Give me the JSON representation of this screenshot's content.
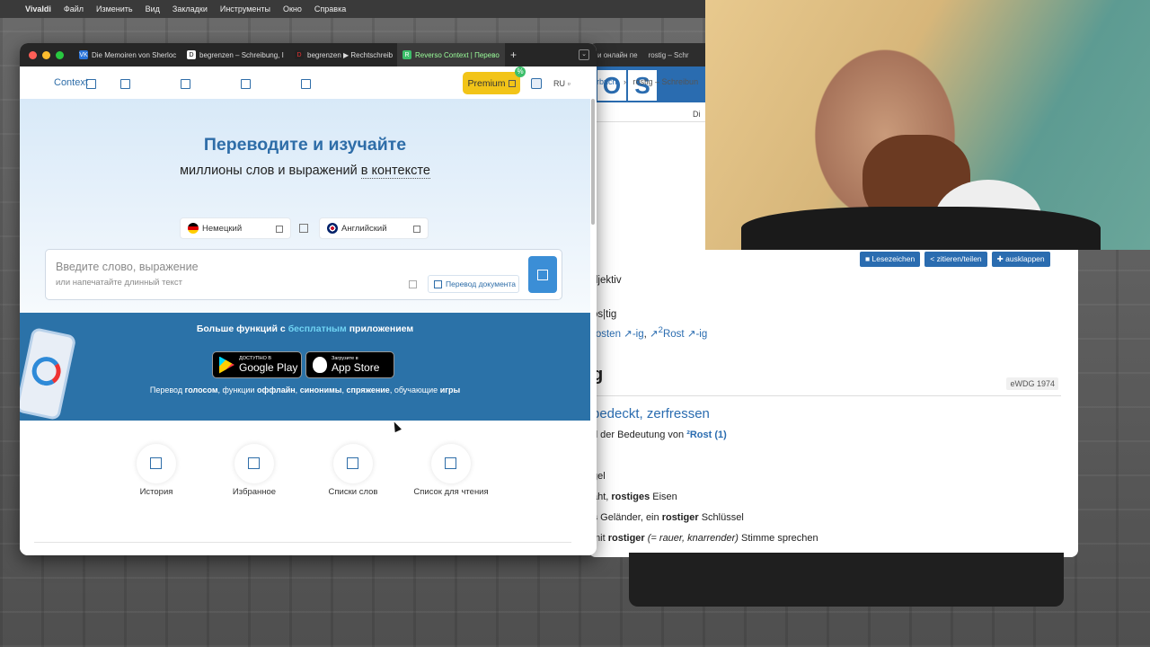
{
  "menubar": {
    "apple": "",
    "app": "Vivaldi",
    "items": [
      "Файл",
      "Изменить",
      "Вид",
      "Закладки",
      "Инструменты",
      "Окно",
      "Справка"
    ]
  },
  "browser_tabs": [
    {
      "icon": "vk",
      "label": "Die Memoiren von Sherloc"
    },
    {
      "icon": "D",
      "label": "begrenzen – Schreibung, I"
    },
    {
      "icon": "D",
      "label": "begrenzen ▶ Rechtschreib"
    },
    {
      "icon": "rev",
      "label": "Reverso Context | Перево",
      "active": true
    }
  ],
  "reverso": {
    "logo": "Context",
    "premium_label": "Premium",
    "lang_code": "RU",
    "hero_title": "Переводите и изучайте",
    "hero_sub_part1": "миллионы слов и выражений ",
    "hero_sub_part2": "в контексте",
    "source_lang": "Немецкий",
    "target_lang": "Английский",
    "search_placeholder": "Введите слово, выражение",
    "search_hint": "или напечатайте длинный текст",
    "doc_translate": "Перевод документа",
    "app_title_part1": "Больше функций с ",
    "app_title_highlight": "бесплатным",
    "app_title_part2": " приложением",
    "google_play_small": "ДОСТУПНО В",
    "google_play_big": "Google Play",
    "app_store_small": "Загрузите в",
    "app_store_big": "App Store",
    "features": [
      {
        "text": "Перевод ",
        "bold": false
      },
      {
        "text": "голосом",
        "bold": true
      },
      {
        "text": ", функции ",
        "bold": false
      },
      {
        "text": "оффлайн",
        "bold": true
      },
      {
        "text": ", ",
        "bold": false
      },
      {
        "text": "синонимы",
        "bold": true
      },
      {
        "text": ", ",
        "bold": false
      },
      {
        "text": "спряжение",
        "bold": true
      },
      {
        "text": ", обучающие ",
        "bold": false
      },
      {
        "text": "игры",
        "bold": true
      }
    ],
    "quick_links": [
      "История",
      "Избранное",
      "Списки слов",
      "Список для чтения"
    ]
  },
  "dwds": {
    "tab_label_partial": "и онлайн пе",
    "tab2_label": "rostig – Schr",
    "di_label": "Di",
    "crumb1": "erbuch",
    "crumb2": "rostig – Schreibun",
    "btn_bookmarks": "Lesezeichen",
    "btn_cite": "zitieren/teilen",
    "btn_expand": "ausklappen",
    "wordclass": "djektiv",
    "paren": ")",
    "syllables": "os|tig",
    "etym_link1": "rosten",
    "etym_suffix1": "-ig",
    "etym_link2": "Rost",
    "etym_suffix2": "-ig",
    "headword_tail": "g",
    "source_badge": "eWDG 1974",
    "meaning": "bedeckt, zerfressen",
    "meaning_note": "d der Bedeutung von ",
    "meaning_ref": "²Rost (1)",
    "example1": "gel",
    "example2_pre": "aht, ",
    "example2_bold": "rostiges",
    "example2_post": " Eisen",
    "example3_pre": "s",
    "example3_mid": " Geländer, ein ",
    "example3_bold": "rostiger",
    "example3_post": " Schlüssel",
    "example4_pre": "mit ",
    "example4_bold": "rostiger",
    "example4_italic": " (= rauer, knarrender)",
    "example4_post": " Stimme sprechen"
  },
  "colors": {
    "reverso_blue": "#2e6da8",
    "premium_yellow": "#f2c418",
    "app_band": "#2b72a8",
    "dwds_blue": "#2a6cb0"
  }
}
